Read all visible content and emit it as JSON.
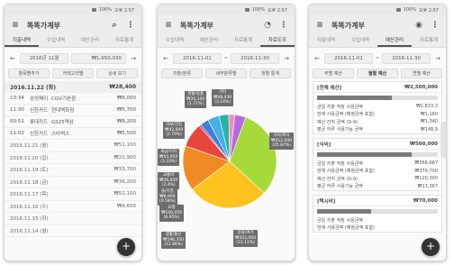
{
  "status": {
    "signal": "▾▴",
    "battery": "100%",
    "time": "오후 2:57"
  },
  "app": {
    "title": "똑똑가계부"
  },
  "tabs": [
    "지출내역",
    "수입내역",
    "예산관리",
    "자료통계",
    "자료도우"
  ],
  "screen1": {
    "period": "2016년 11월",
    "total": "₩1,650,030",
    "buttons": [
      "항목별추가",
      "카테고리별",
      "상세 보기"
    ],
    "day_header": {
      "date": "2016.11.22 (화)",
      "amount": "₩28,400"
    },
    "items": [
      {
        "time": "13:34",
        "account": "삼성페이",
        "desc": "CGV기본점",
        "amount": "₩9,000"
      },
      {
        "time": "11:30",
        "account": "신한카드",
        "desc": "현대백화점",
        "amount": "₩5,700"
      },
      {
        "time": "00:51",
        "account": "롯데카드",
        "desc": "GS25역삼",
        "amount": "₩8,200"
      },
      {
        "time": "11:02",
        "account": "신한카드",
        "desc": "스타벅스",
        "amount": "₩5,500"
      }
    ],
    "days": [
      {
        "date": "2016.11.21 (월)",
        "amount": "₩51,100"
      },
      {
        "date": "2016.11.20 (일)",
        "amount": "₩22,900"
      },
      {
        "date": "2016.11.19 (토)",
        "amount": "₩33,700"
      },
      {
        "date": "2016.11.18 (금)",
        "amount": "₩36,200"
      },
      {
        "date": "2016.11.17 (목)",
        "amount": "₩51,100"
      },
      {
        "date": "2016.11.16 (수)",
        "amount": "₩9,650"
      },
      {
        "date": "2016.11.15 (화)",
        "amount": ""
      },
      {
        "date": "2016.11.14 (월)",
        "amount": ""
      }
    ],
    "fab": "+"
  },
  "screen2": {
    "period_start": "2016-11-01",
    "period_end": "2016-11-30",
    "buttons": [
      "지출/분류",
      "세부분류별",
      "월별 통계"
    ],
    "labels": [
      {
        "text": "기타\n₩48,030\n(3.14%)"
      },
      {
        "text": "생활/용품\n₩26,100\n(1.71%)"
      },
      {
        "text": "의료/건강\n₩42,600\n(2.79%)"
      },
      {
        "text": "세금/이자\n₩50,950\n(3.33%)"
      },
      {
        "text": "교통비\n₩36,650\n(2.4%)"
      },
      {
        "text": "식비/외식\n₩412,000\n(25.87%)"
      },
      {
        "text": "술/유흥\n₩8,900\n(0.58%)"
      },
      {
        "text": "쇼핑\n₩106,050\n(6.95%)"
      },
      {
        "text": "생활/통신\n₩196,350\n(12.86%)"
      },
      {
        "text": "문화/여가\n₩353,000\n(23.11%)"
      }
    ],
    "chart_data": {
      "type": "pie",
      "slices": [
        {
          "name": "식비/외식",
          "value": 25.87,
          "color": "#a6d93a"
        },
        {
          "name": "문화/여가",
          "value": 23.11,
          "color": "#ffc31f"
        },
        {
          "name": "생활/통신",
          "value": 12.86,
          "color": "#f08a24"
        },
        {
          "name": "쇼핑",
          "value": 6.95,
          "color": "#e8453c"
        },
        {
          "name": "술/유흥",
          "value": 0.58,
          "color": "#c43b8c"
        },
        {
          "name": "교통비",
          "value": 2.4,
          "color": "#3d7fd9"
        },
        {
          "name": "세금/이자",
          "value": 3.33,
          "color": "#45b0e6"
        },
        {
          "name": "의료/건강",
          "value": 2.79,
          "color": "#27b5a8"
        },
        {
          "name": "생활/용품",
          "value": 1.71,
          "color": "#f28db2"
        },
        {
          "name": "기타",
          "value": 3.14,
          "color": "#b56be0"
        }
      ]
    }
  },
  "screen3": {
    "period_start": "2016-11-01",
    "period_end": "2016-11-30",
    "buttons": [
      "주별 예산",
      "월별 예산",
      "연별 예산"
    ],
    "categories": [
      {
        "name": "[전체 예산]",
        "budget": "₩2,500,000",
        "fill": 0.62,
        "lines": [
          {
            "label": "금일 지출 적정 사용금액",
            "amount": "₩1,833,3"
          },
          {
            "label": "현재 사용금액 (예정금액 포함)",
            "amount": "₩1,160"
          },
          {
            "label": "예산 잔여 금액 (D-9)",
            "amount": "₩1,340"
          },
          {
            "label": "평균 하루 사용가능 금액",
            "amount": "₩148,9"
          }
        ]
      },
      {
        "name": "[식비]",
        "budget": "₩500,000",
        "fill": 0.78,
        "lines": [
          {
            "label": "금일 지출 적정 사용금액",
            "amount": "₩366,667"
          },
          {
            "label": "현재 사용금액 (예정금액 포함)",
            "amount": "₩379,700"
          },
          {
            "label": "예산 잔여 금액 (D-9)",
            "amount": "₩120,300"
          },
          {
            "label": "평균 하루 사용가능 금액",
            "amount": "₩13,367"
          }
        ]
      },
      {
        "name": "[택시비]",
        "budget": "₩70,000",
        "fill": 0.45,
        "lines": [
          {
            "label": "금일 지출 적정 사용금액",
            "amount": ""
          },
          {
            "label": "현재 사용금액 (예정금액 포함)",
            "amount": ""
          }
        ]
      }
    ],
    "fab": "+"
  },
  "icons": {
    "menu": "menu-icon",
    "search": "search-icon",
    "more": "more-icon",
    "chart": "pie-chart-icon",
    "eye": "eye-icon"
  }
}
